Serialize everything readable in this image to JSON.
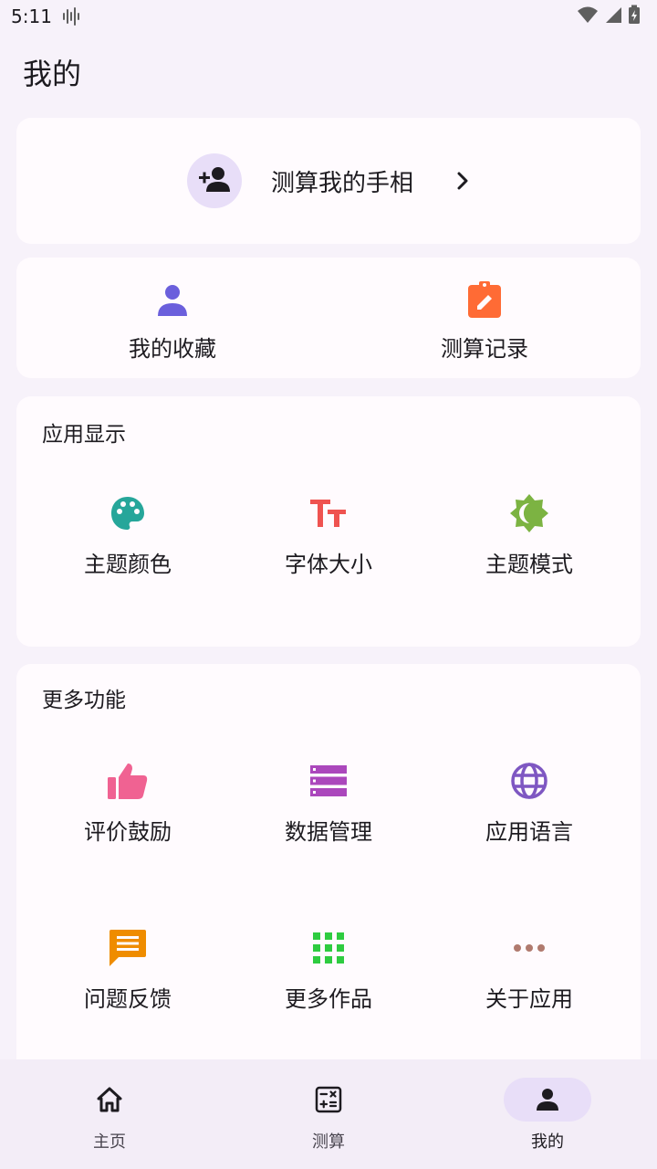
{
  "status_bar": {
    "time": "5:11"
  },
  "page": {
    "title": "我的"
  },
  "profile": {
    "label": "测算我的手相"
  },
  "quick": [
    {
      "label": "我的收藏",
      "icon": "person-icon",
      "color": "#6b5fdc"
    },
    {
      "label": "测算记录",
      "icon": "clipboard-edit-icon",
      "color": "#ff6b35"
    }
  ],
  "display_section": {
    "title": "应用显示",
    "items": [
      {
        "label": "主题颜色",
        "icon": "palette-icon",
        "color": "#26a69a"
      },
      {
        "label": "字体大小",
        "icon": "text-size-icon",
        "color": "#ef5350"
      },
      {
        "label": "主题模式",
        "icon": "brightness-icon",
        "color": "#7cb342"
      }
    ]
  },
  "more_section": {
    "title": "更多功能",
    "items": [
      {
        "label": "评价鼓励",
        "icon": "thumb-up-icon",
        "color": "#f06292"
      },
      {
        "label": "数据管理",
        "icon": "storage-icon",
        "color": "#ab47bc"
      },
      {
        "label": "应用语言",
        "icon": "globe-icon",
        "color": "#7e57c2"
      },
      {
        "label": "问题反馈",
        "icon": "feedback-icon",
        "color": "#ef8c00"
      },
      {
        "label": "更多作品",
        "icon": "apps-icon",
        "color": "#2ecc40"
      },
      {
        "label": "关于应用",
        "icon": "more-dots-icon",
        "color": "#b07a6e"
      }
    ]
  },
  "bottom_nav": [
    {
      "label": "主页",
      "icon": "home-icon"
    },
    {
      "label": "测算",
      "icon": "calculator-icon"
    },
    {
      "label": "我的",
      "icon": "person-icon",
      "active": true
    }
  ]
}
